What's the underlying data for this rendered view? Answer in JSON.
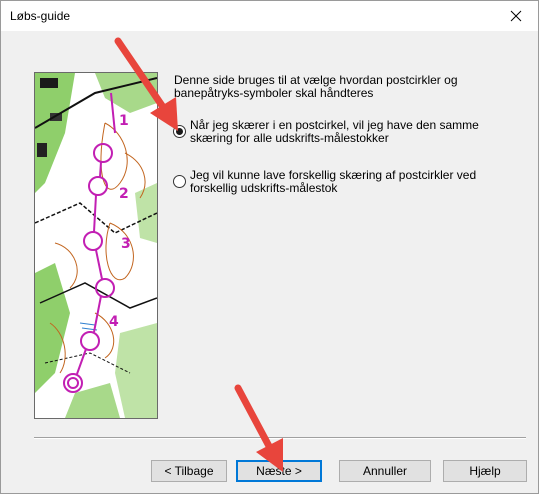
{
  "window": {
    "title": "Løbs-guide",
    "close_icon": "close-icon"
  },
  "description": "Denne side bruges til at vælge hvordan postcirkler og banepåtryks-symboler skal håndteres",
  "options": [
    {
      "label": "Når jeg skærer i en postcirkel, vil jeg have den samme skæring for alle udskrifts-målestokker",
      "selected": true
    },
    {
      "label": "Jeg vil kunne lave forskellig skæring af postcirkler ved forskellig udskrifts-målestok",
      "selected": false
    }
  ],
  "buttons": {
    "back": "< Tilbage",
    "next": "Næste >",
    "cancel": "Annuller",
    "help": "Hjælp"
  },
  "map_labels": [
    "1",
    "2",
    "3",
    "4"
  ],
  "colors": {
    "course_purple": "#c21fb3",
    "contour_brown": "#c2651f",
    "vegetation_green": "#8fcf6b",
    "annotation_arrow": "#e8453c",
    "default_button_border": "#0078d7"
  }
}
